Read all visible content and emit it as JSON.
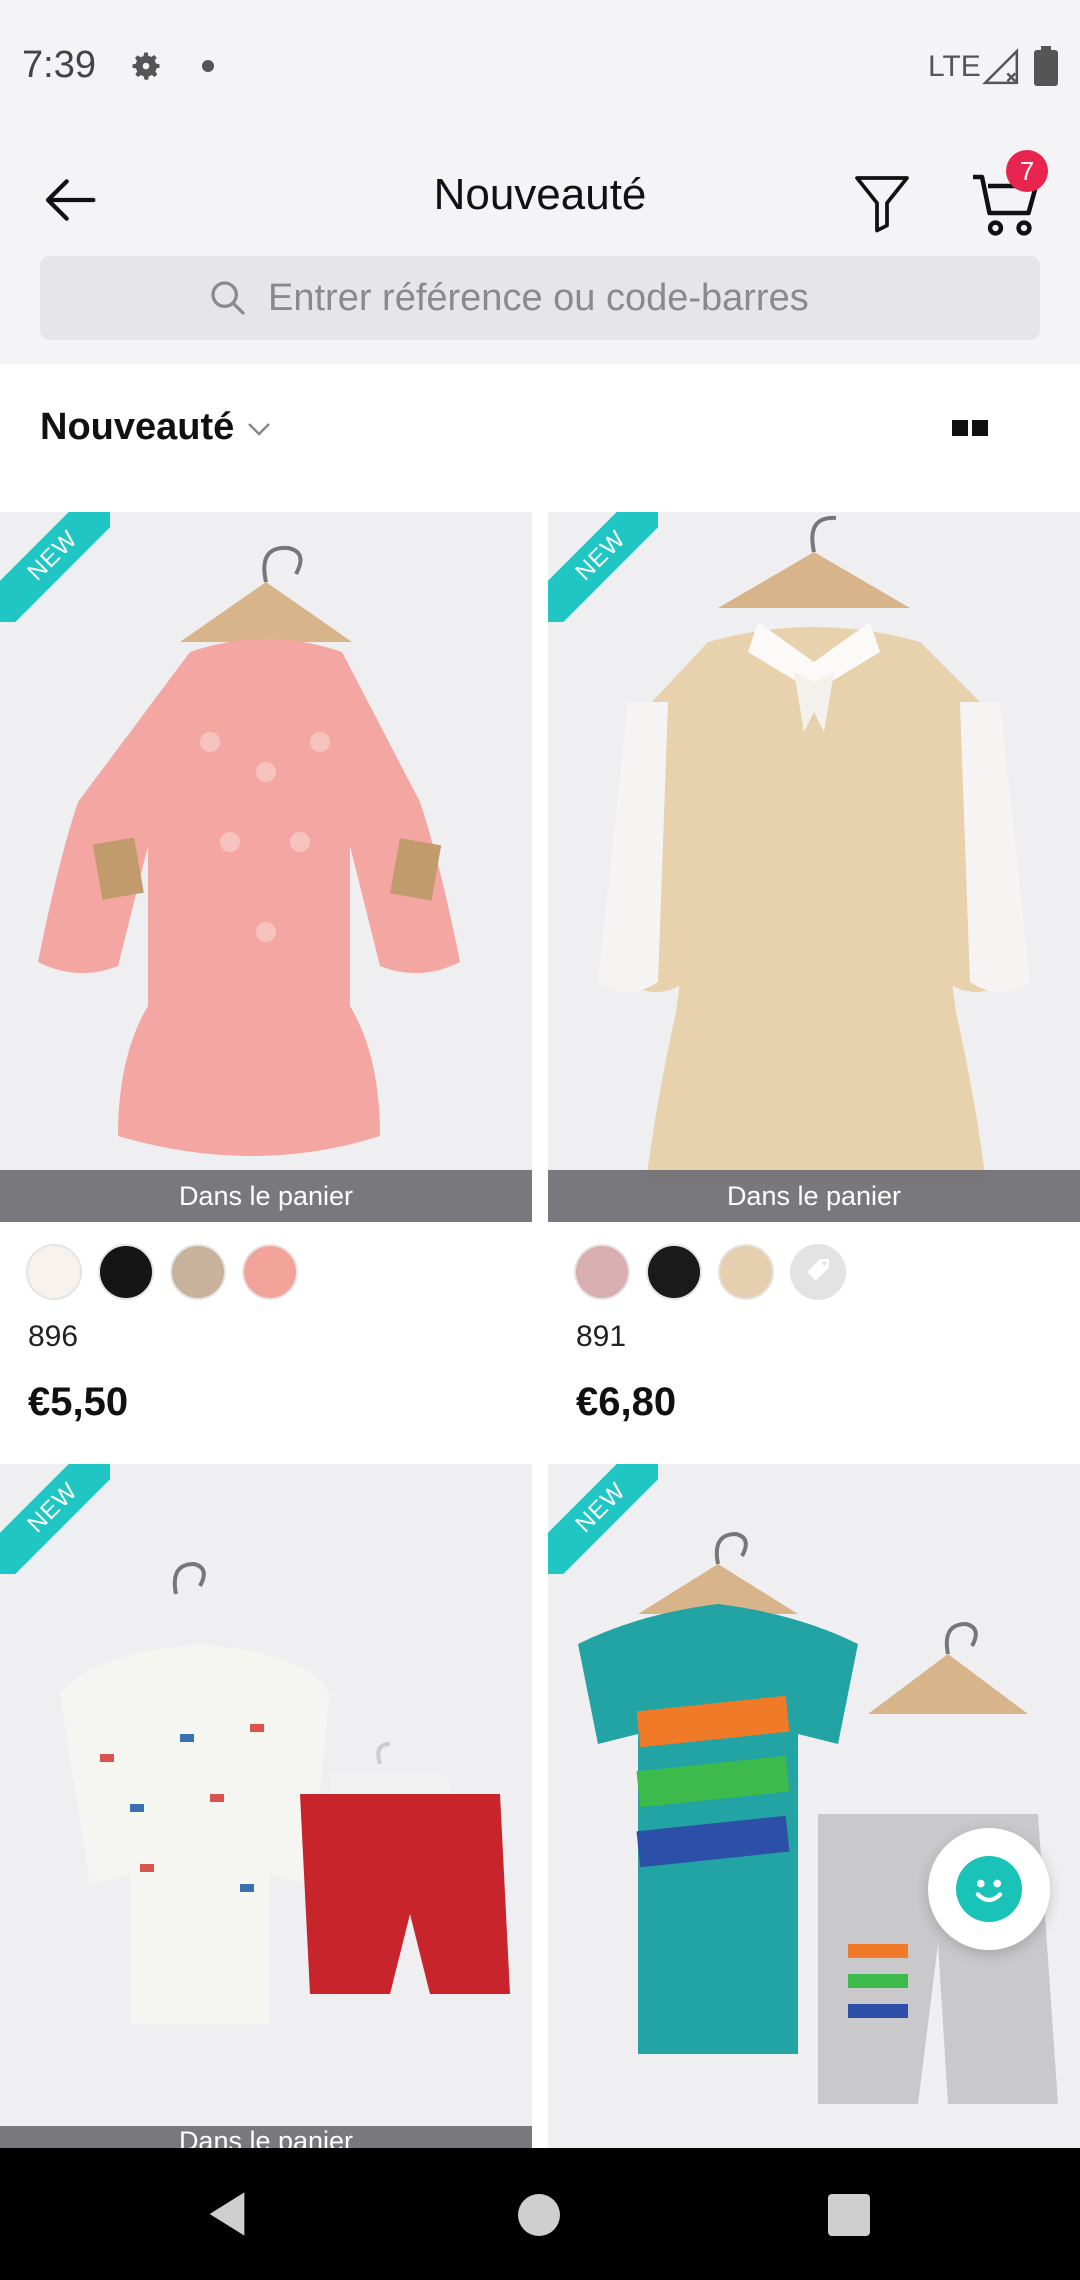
{
  "status_bar": {
    "time": "7:39",
    "network": "LTE"
  },
  "header": {
    "title": "Nouveauté",
    "cart_count": "7",
    "search_placeholder": "Entrer référence ou code-barres"
  },
  "sort": {
    "label": "Nouveauté"
  },
  "colors": {
    "accent_teal": "#1fc6c3",
    "badge_red": "#e8254e",
    "header_bg": "#f4f3f6"
  },
  "products": [
    {
      "ribbon": "NEW",
      "cart_label": "Dans le panier",
      "ref": "896",
      "price": "€5,50",
      "swatches": [
        "#f7f2ee",
        "#151515",
        "#c9b29c",
        "#f2a49a"
      ]
    },
    {
      "ribbon": "NEW",
      "cart_label": "Dans le panier",
      "ref": "891",
      "price": "€6,80",
      "swatches": [
        "#d8aeb0",
        "#1a1a1a",
        "#e5cfae",
        "tag-icon"
      ]
    },
    {
      "ribbon": "NEW",
      "cart_label": "Dans le panier"
    },
    {
      "ribbon": "NEW"
    }
  ]
}
